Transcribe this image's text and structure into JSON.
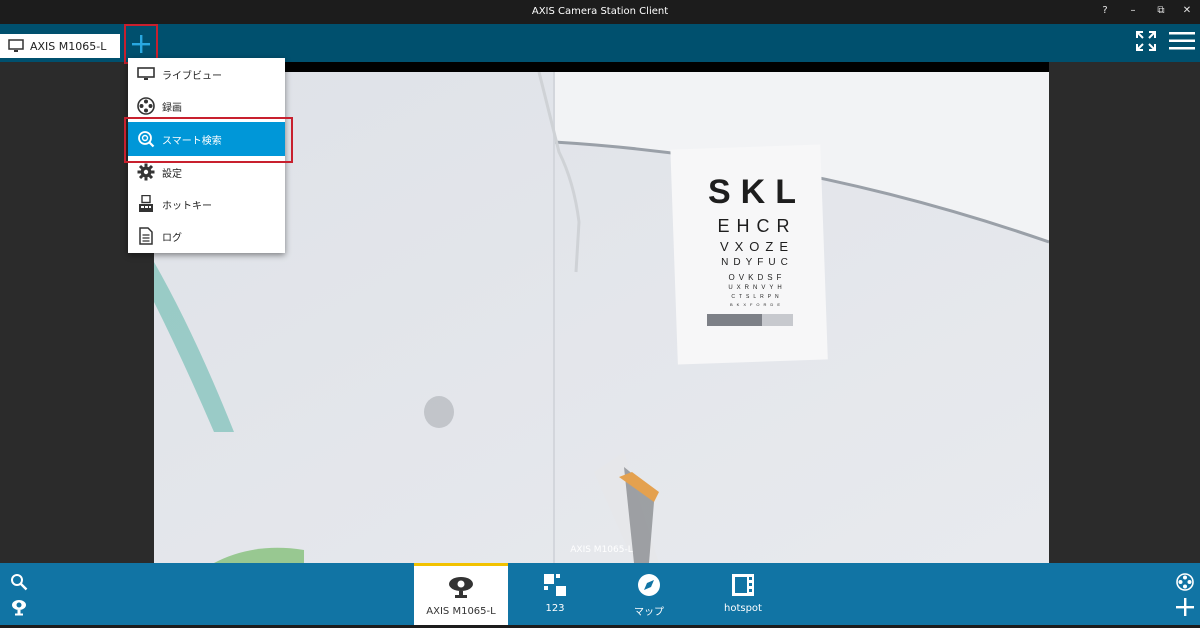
{
  "window": {
    "title": "AXIS Camera Station Client",
    "help_label": "?",
    "minimize_label": "–",
    "restore_label": "⧉",
    "close_label": "✕"
  },
  "camera_tab": {
    "label": "AXIS M1065-L",
    "icon": "monitor-icon"
  },
  "toolbar": {
    "add_icon": "plus-icon",
    "fullscreen_icon": "fullscreen-icon",
    "menu_icon": "hamburger-menu-icon"
  },
  "menu": {
    "items": [
      {
        "label": "ライブビュー",
        "icon": "monitor-icon"
      },
      {
        "label": "録画",
        "icon": "film-reel-icon"
      },
      {
        "label": "スマート検索",
        "icon": "smart-search-icon",
        "selected": true
      },
      {
        "label": "設定",
        "icon": "gear-icon"
      },
      {
        "label": "ホットキー",
        "icon": "hotkey-icon"
      },
      {
        "label": "ログ",
        "icon": "log-icon"
      }
    ]
  },
  "video": {
    "camera_overlay": "AXIS M1065-L",
    "chart_lines": [
      "SKL",
      "EHCR",
      "VXOZE",
      "NDYFUC",
      "OVKDSF",
      "UXRNVYH",
      "CTSLRPN",
      "BKXFORDE"
    ]
  },
  "bottom": {
    "tabs": [
      {
        "label": "AXIS M1065-L",
        "icon": "camera-icon",
        "active": true
      },
      {
        "label": "123",
        "icon": "view-layout-icon"
      },
      {
        "label": "マップ",
        "icon": "compass-icon"
      },
      {
        "label": "hotspot",
        "icon": "hotspot-icon"
      }
    ],
    "left_icons": [
      "search-icon",
      "camera-alert-icon"
    ],
    "right_icons": [
      "film-reel-icon",
      "plus-icon"
    ]
  },
  "colors": {
    "toolbar": "#00506e",
    "bottombar": "#1174a4",
    "selected": "#0097d8",
    "highlight": "#c8202e",
    "active_accent": "#f2c200"
  }
}
